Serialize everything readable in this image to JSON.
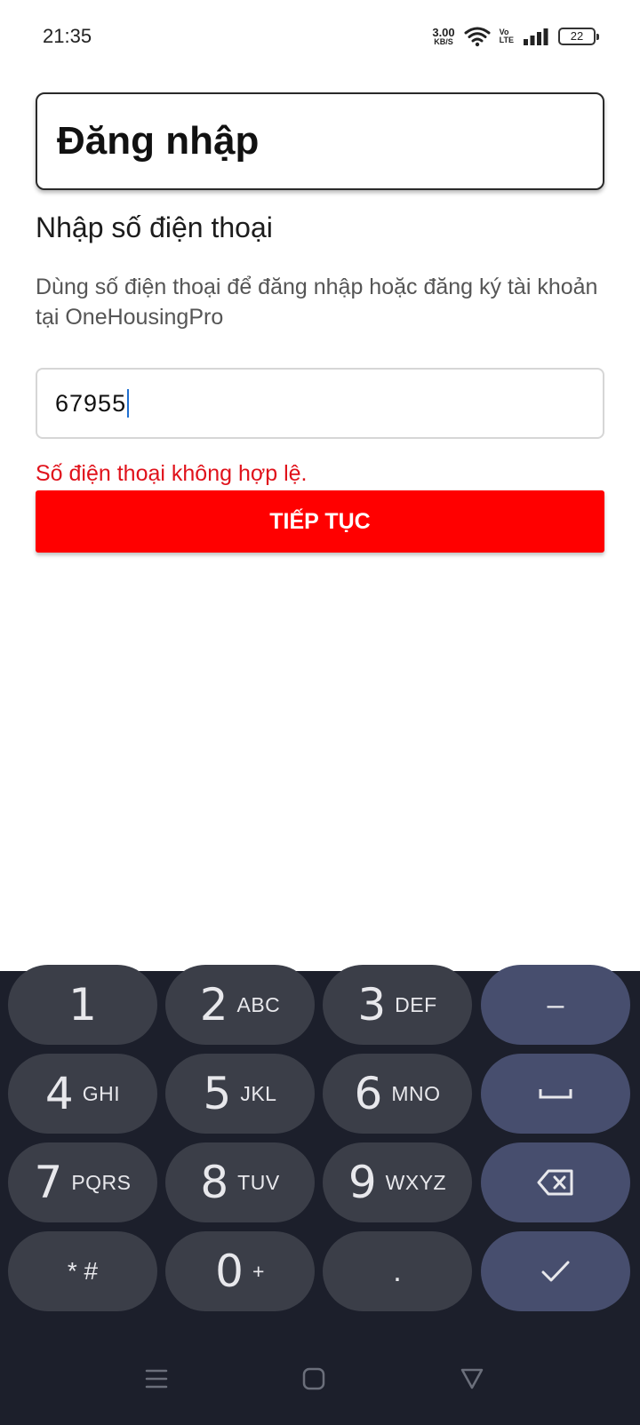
{
  "status_bar": {
    "time": "21:35",
    "net_speed_value": "3.00",
    "net_speed_unit": "KB/S",
    "volte_top": "Vo",
    "volte_bottom": "LTE",
    "battery": "22",
    "icons": [
      "wifi-icon",
      "signal-icon",
      "battery-icon"
    ]
  },
  "header": {
    "title": "Đăng nhập"
  },
  "form": {
    "subtitle": "Nhập số điện thoại",
    "description": "Dùng số điện thoại để đăng nhập hoặc đăng ký tài khoản tại OneHousingPro",
    "phone_value": "67955",
    "error": "Số điện thoại không hợp lệ.",
    "continue_label": "TIẾP TỤC"
  },
  "keyboard": {
    "keys": [
      {
        "num": "1",
        "letters": ""
      },
      {
        "num": "2",
        "letters": "ABC"
      },
      {
        "num": "3",
        "letters": "DEF"
      },
      {
        "num": "4",
        "letters": "GHI"
      },
      {
        "num": "5",
        "letters": "JKL"
      },
      {
        "num": "6",
        "letters": "MNO"
      },
      {
        "num": "7",
        "letters": "PQRS"
      },
      {
        "num": "8",
        "letters": "TUV"
      },
      {
        "num": "9",
        "letters": "WXYZ"
      },
      {
        "num": "0",
        "letters": "+"
      }
    ],
    "star_hash": "* #",
    "dot": ".",
    "minus": "–",
    "function_keys": [
      "minus-key",
      "space-key",
      "backspace-key",
      "done-key"
    ]
  },
  "nav_bar": {
    "icons": [
      "menu-icon",
      "home-icon",
      "back-icon"
    ]
  },
  "colors": {
    "accent": "#ff0000",
    "error": "#e0121b",
    "keyboard_bg": "#1c1f2b",
    "key_bg": "#3b3e48",
    "function_key_bg": "#474e6e"
  }
}
